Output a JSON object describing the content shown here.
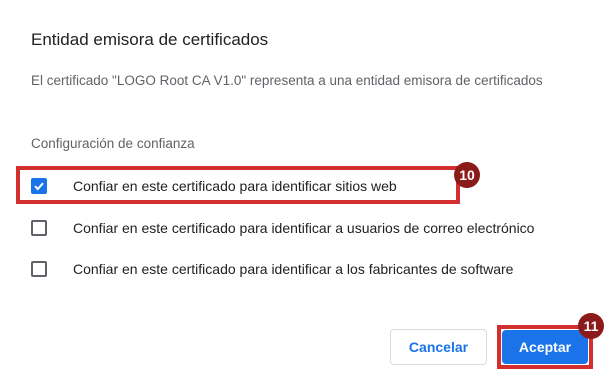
{
  "dialog": {
    "title": "Entidad emisora de certificados",
    "description": "El certificado \"LOGO Root CA V1.0\" representa a una entidad emisora de certificados",
    "trust_section_label": "Configuración de confianza",
    "options": [
      {
        "label": "Confiar en este certificado para identificar sitios web",
        "checked": true
      },
      {
        "label": "Confiar en este certificado para identificar a usuarios de correo electrónico",
        "checked": false
      },
      {
        "label": "Confiar en este certificado para identificar a los fabricantes de software",
        "checked": false
      }
    ],
    "buttons": {
      "cancel": "Cancelar",
      "accept": "Aceptar"
    }
  },
  "annotations": {
    "step_10": "10",
    "step_11": "11"
  },
  "icons": {
    "checkmark": "checkmark-icon"
  },
  "colors": {
    "accent": "#1a73e8",
    "highlight": "#d32f2f",
    "badge": "#8b1a1a"
  }
}
